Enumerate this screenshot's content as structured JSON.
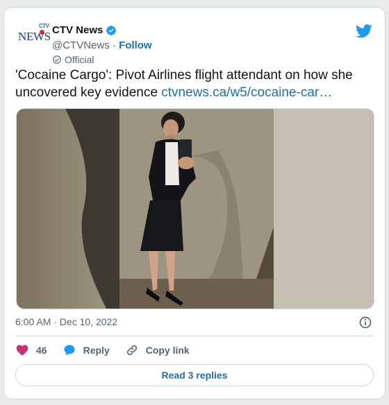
{
  "author": {
    "name": "CTV News",
    "handle": "@CTVNews",
    "separator": "·",
    "follow_label": "Follow",
    "badge_label": "Official",
    "logo_top": "CTV",
    "logo_main": "NEWS"
  },
  "tweet": {
    "text": "'Cocaine Cargo': Pivot Airlines flight attendant on how she uncovered key evidence ",
    "link_text": "ctvnews.ca/w5/cocaine-car…",
    "timestamp": "6:00 AM · Dec 10, 2022"
  },
  "actions": {
    "like_count": "46",
    "reply_label": "Reply",
    "copy_label": "Copy link"
  },
  "read_replies_label": "Read 3 replies",
  "colors": {
    "link": "#1d6fa5",
    "verified": "#1d9bf0",
    "heart": "#c9317a",
    "twitter_bird": "#1d9bf0"
  }
}
